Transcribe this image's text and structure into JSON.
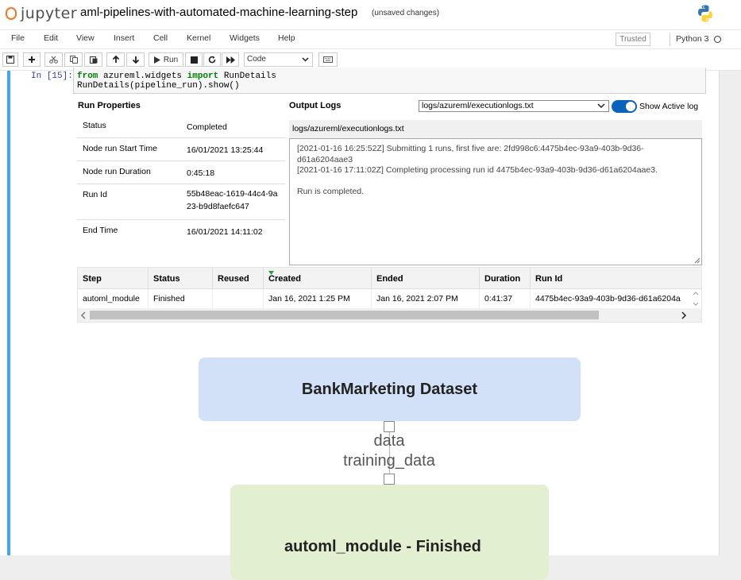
{
  "header": {
    "logo_text": "jupyter",
    "notebook_title": "aml-pipelines-with-automated-machine-learning-step",
    "save_status": "(unsaved changes)"
  },
  "menubar": {
    "items": [
      "File",
      "Edit",
      "View",
      "Insert",
      "Cell",
      "Kernel",
      "Widgets",
      "Help"
    ],
    "trusted_label": "Trusted",
    "kernel_name": "Python 3"
  },
  "toolbar": {
    "run_label": "Run",
    "cell_type": "Code"
  },
  "cell": {
    "prompt": "In [15]:",
    "code_line1_kw1": "from",
    "code_line1_mod": " azureml.widgets ",
    "code_line1_kw2": "import",
    "code_line1_name": " RunDetails",
    "code_line2": "RunDetails(pipeline_run).show()"
  },
  "run_properties": {
    "title": "Run Properties",
    "rows": [
      {
        "key": "Status",
        "value": "Completed"
      },
      {
        "key": "Node run Start Time",
        "value": "16/01/2021 13:25:44"
      },
      {
        "key": "Node run Duration",
        "value": "0:45:18"
      },
      {
        "key": "Run Id",
        "value": "55b48eac-1619-44c4-9a23-b9d8faefc647"
      },
      {
        "key": "End Time",
        "value": "16/01/2021 14:11:02"
      }
    ]
  },
  "output_logs": {
    "title": "Output Logs",
    "selected_log": "logs/azureml/executionlogs.txt",
    "toggle_label": "Show Active log",
    "toggle_on": true,
    "log_header": "logs/azureml/executionlogs.txt",
    "lines": [
      "[2021-01-16 16:25:52Z] Submitting 1 runs, first five are: 2fd998c6:4475b4ec-93a9-403b-9d36-d61a6204aae3",
      "[2021-01-16 17:11:02Z] Completing processing run id 4475b4ec-93a9-403b-9d36-d61a6204aae3.",
      "Run is completed."
    ]
  },
  "steps_table": {
    "columns": [
      "Step",
      "Status",
      "Reused",
      "Created",
      "Ended",
      "Duration",
      "Run Id"
    ],
    "rows": [
      [
        "automl_module",
        "Finished",
        "",
        "Jan 16, 2021 1:25 PM",
        "Jan 16, 2021 2:07 PM",
        "0:41:37",
        "4475b4ec-93a9-403b-9d36-d61a6204a"
      ]
    ]
  },
  "graph": {
    "dataset_node": "BankMarketing Dataset",
    "edge_label_1": "data",
    "edge_label_2": "training_data",
    "module_node": "automl_module - Finished"
  },
  "colors": {
    "accent": "#42a5f5",
    "toggle": "#0b62ba",
    "dataset_node": "#d2e1f7",
    "module_node": "#e2f0d1",
    "jupyter_orange": "#f37726"
  }
}
